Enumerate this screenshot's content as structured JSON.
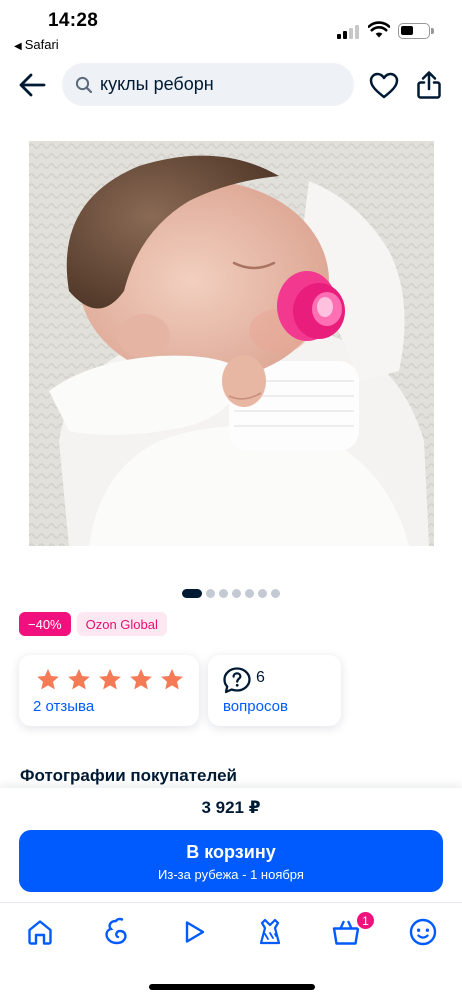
{
  "status_bar": {
    "time": "14:28",
    "back_app": "Safari"
  },
  "header": {
    "search_query": "куклы реборн",
    "icons": [
      "back-arrow-icon",
      "search-icon",
      "heart-icon",
      "share-icon"
    ]
  },
  "photo": {
    "alt": "sleeping reborn baby doll with pink pacifier",
    "dots_total": 7,
    "active_dot": 0
  },
  "badges": {
    "discount": "−40%",
    "seller_program": "Ozon Global"
  },
  "rating": {
    "stars": 5,
    "reviews_link": "2 отзыва"
  },
  "questions": {
    "count": "6",
    "link": "вопросов"
  },
  "section_title": "Фотографии покупателей",
  "buy_panel": {
    "price": "3 921 ₽",
    "button_label": "В корзину",
    "button_sub": "Из-за рубежа - 1 ноября"
  },
  "bottom_nav": {
    "items": [
      "home-icon",
      "fresh-icon",
      "video-icon",
      "fashion-icon",
      "cart-icon",
      "profile-icon"
    ],
    "cart_count": "1"
  },
  "colors": {
    "accent": "#005bff",
    "discount": "#f1117e",
    "star": "#f57a56",
    "text": "#001a34"
  }
}
